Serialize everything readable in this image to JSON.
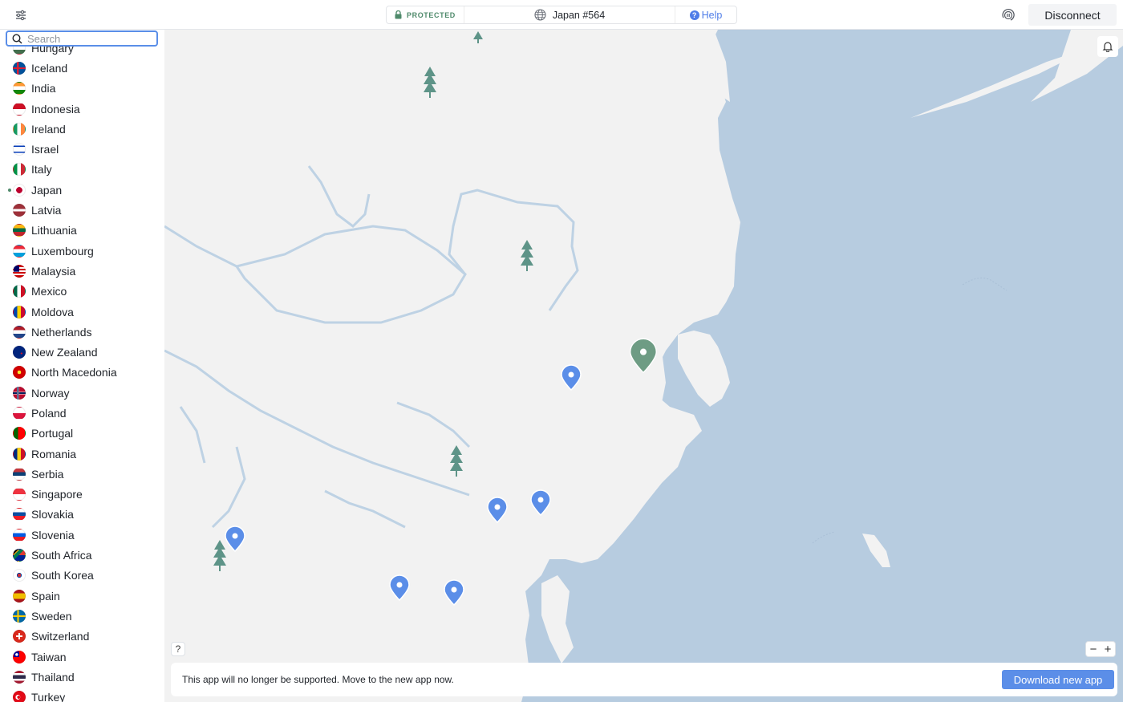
{
  "header": {
    "status": "PROTECTED",
    "server": "Japan #564",
    "help_label": "Help",
    "disconnect_label": "Disconnect"
  },
  "search": {
    "placeholder": "Search"
  },
  "sidebar": {
    "active_country": "Japan",
    "countries": [
      {
        "name": "Hungary",
        "flag": "hungary"
      },
      {
        "name": "Iceland",
        "flag": "iceland"
      },
      {
        "name": "India",
        "flag": "india"
      },
      {
        "name": "Indonesia",
        "flag": "indonesia"
      },
      {
        "name": "Ireland",
        "flag": "ireland"
      },
      {
        "name": "Israel",
        "flag": "israel"
      },
      {
        "name": "Italy",
        "flag": "italy"
      },
      {
        "name": "Japan",
        "flag": "japan"
      },
      {
        "name": "Latvia",
        "flag": "latvia"
      },
      {
        "name": "Lithuania",
        "flag": "lithuania"
      },
      {
        "name": "Luxembourg",
        "flag": "luxembourg"
      },
      {
        "name": "Malaysia",
        "flag": "malaysia"
      },
      {
        "name": "Mexico",
        "flag": "mexico"
      },
      {
        "name": "Moldova",
        "flag": "moldova"
      },
      {
        "name": "Netherlands",
        "flag": "netherlands"
      },
      {
        "name": "New Zealand",
        "flag": "new-zealand"
      },
      {
        "name": "North Macedonia",
        "flag": "north-macedonia"
      },
      {
        "name": "Norway",
        "flag": "norway"
      },
      {
        "name": "Poland",
        "flag": "poland"
      },
      {
        "name": "Portugal",
        "flag": "portugal"
      },
      {
        "name": "Romania",
        "flag": "romania"
      },
      {
        "name": "Serbia",
        "flag": "serbia"
      },
      {
        "name": "Singapore",
        "flag": "singapore"
      },
      {
        "name": "Slovakia",
        "flag": "slovakia"
      },
      {
        "name": "Slovenia",
        "flag": "slovenia"
      },
      {
        "name": "South Africa",
        "flag": "south-africa"
      },
      {
        "name": "South Korea",
        "flag": "south-korea"
      },
      {
        "name": "Spain",
        "flag": "spain"
      },
      {
        "name": "Sweden",
        "flag": "sweden"
      },
      {
        "name": "Switzerland",
        "flag": "switzerland"
      },
      {
        "name": "Taiwan",
        "flag": "taiwan"
      },
      {
        "name": "Thailand",
        "flag": "thailand"
      },
      {
        "name": "Turkey",
        "flag": "turkey"
      }
    ]
  },
  "map": {
    "help_label": "?",
    "zoom_out_label": "−",
    "zoom_in_label": "+",
    "banner_text": "This app will no longer be supported. Move to the new app now.",
    "banner_button": "Download new app",
    "colors": {
      "water": "#b7cce0",
      "land": "#f2f2f2",
      "server_pin": "#5b8ee8",
      "connected_pin": "#6e9c84",
      "tree": "#5e9488"
    }
  },
  "colors": {
    "accent": "#5b8ee8",
    "protected": "#4f8a6b"
  }
}
